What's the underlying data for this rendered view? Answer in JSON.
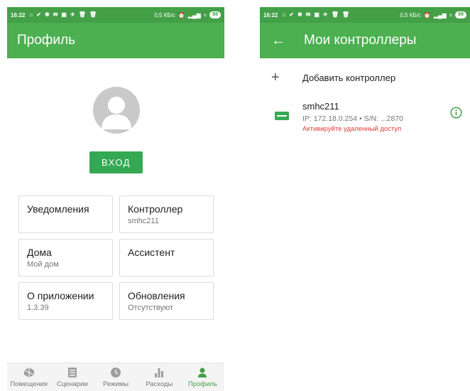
{
  "left": {
    "status": {
      "time": "16:22",
      "net": "0,5 КБ/с",
      "battery": "89"
    },
    "appbar": {
      "title": "Профиль"
    },
    "login_label": "ВХОД",
    "cards": [
      {
        "title": "Уведомления",
        "sub": ""
      },
      {
        "title": "Контроллер",
        "sub": "smhc211"
      },
      {
        "title": "Дома",
        "sub": "Мой дом"
      },
      {
        "title": "Ассистент",
        "sub": ""
      },
      {
        "title": "О приложении",
        "sub": "1.3.39"
      },
      {
        "title": "Обновления",
        "sub": "Отсутствуют"
      }
    ],
    "nav": [
      {
        "label": "Помещения",
        "icon": "rooms-icon"
      },
      {
        "label": "Сценарии",
        "icon": "scenarios-icon"
      },
      {
        "label": "Режимы",
        "icon": "modes-icon"
      },
      {
        "label": "Расходы",
        "icon": "expenses-icon"
      },
      {
        "label": "Профиль",
        "icon": "profile-icon",
        "active": true
      }
    ]
  },
  "right": {
    "status": {
      "time": "16:22",
      "net": "0,5 КБ/с",
      "battery": "89"
    },
    "appbar": {
      "title": "Мои контроллеры"
    },
    "add_label": "Добавить контроллер",
    "controller": {
      "name": "smhc211",
      "meta": "IP: 172.18.0.254 • S/N: ...2870",
      "warning": "Активируйте удаленный доступ"
    }
  },
  "colors": {
    "primary": "#4caf50",
    "statusbar": "#43a047",
    "accent": "#34a853",
    "warning": "#e53935"
  }
}
